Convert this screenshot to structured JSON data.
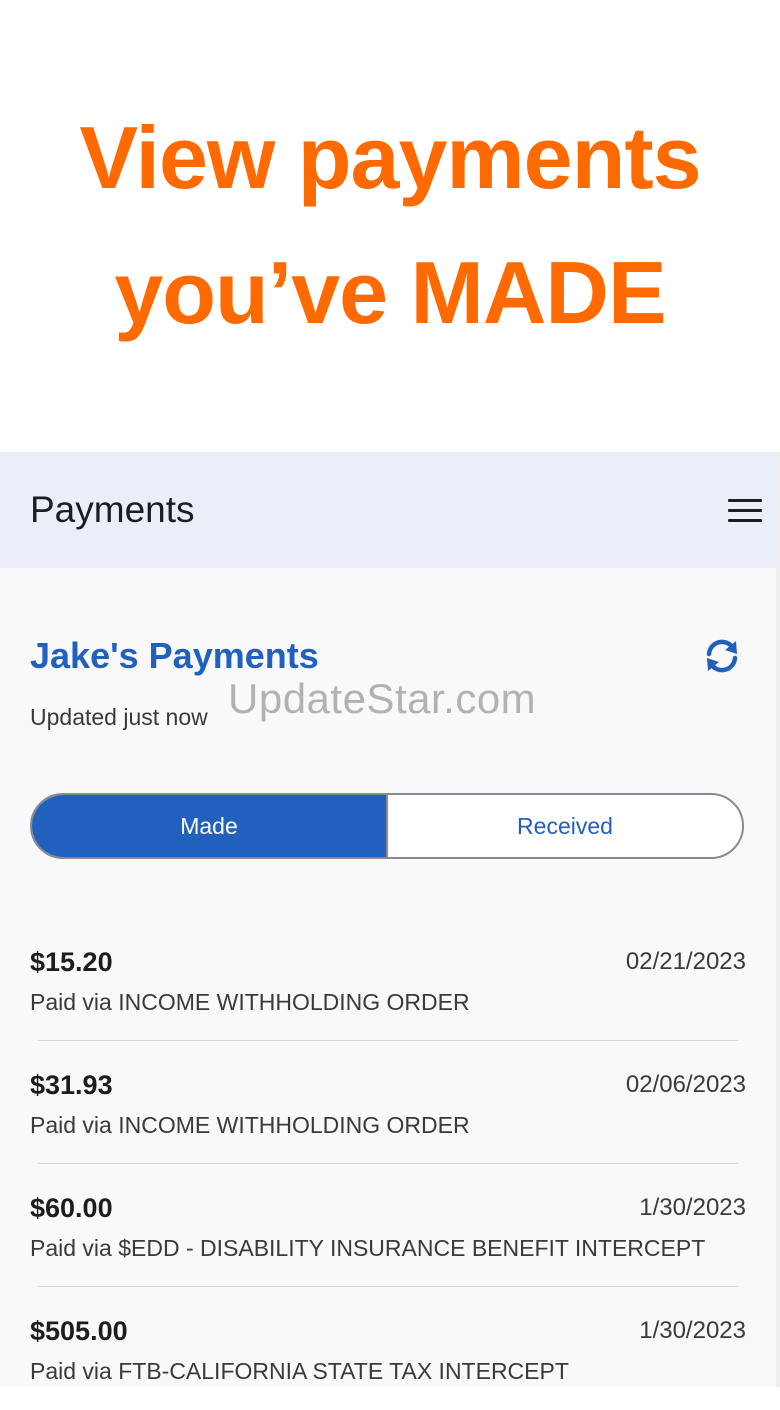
{
  "promo": {
    "line1": "View payments",
    "line2": "you’ve MADE",
    "color": "#ff6a00"
  },
  "appbar": {
    "title": "Payments",
    "menu_icon": "hamburger-menu-icon"
  },
  "section": {
    "title": "Jake's Payments",
    "updated": "Updated just now",
    "refresh_icon": "refresh-icon"
  },
  "watermark": "UpdateStar.com",
  "tabs": {
    "made": "Made",
    "received": "Received",
    "selected": "Made"
  },
  "payments": [
    {
      "amount": "$15.20",
      "date": "02/21/2023",
      "method": "Paid via INCOME WITHHOLDING ORDER"
    },
    {
      "amount": "$31.93",
      "date": "02/06/2023",
      "method": "Paid via INCOME WITHHOLDING ORDER"
    },
    {
      "amount": "$60.00",
      "date": "1/30/2023",
      "method": "Paid via $EDD - DISABILITY INSURANCE BENEFIT INTERCEPT"
    },
    {
      "amount": "$505.00",
      "date": "1/30/2023",
      "method": "Paid via FTB-CALIFORNIA STATE TAX INTERCEPT"
    }
  ],
  "colors": {
    "accent": "#2260be",
    "appbar_bg": "#e9eef8"
  }
}
